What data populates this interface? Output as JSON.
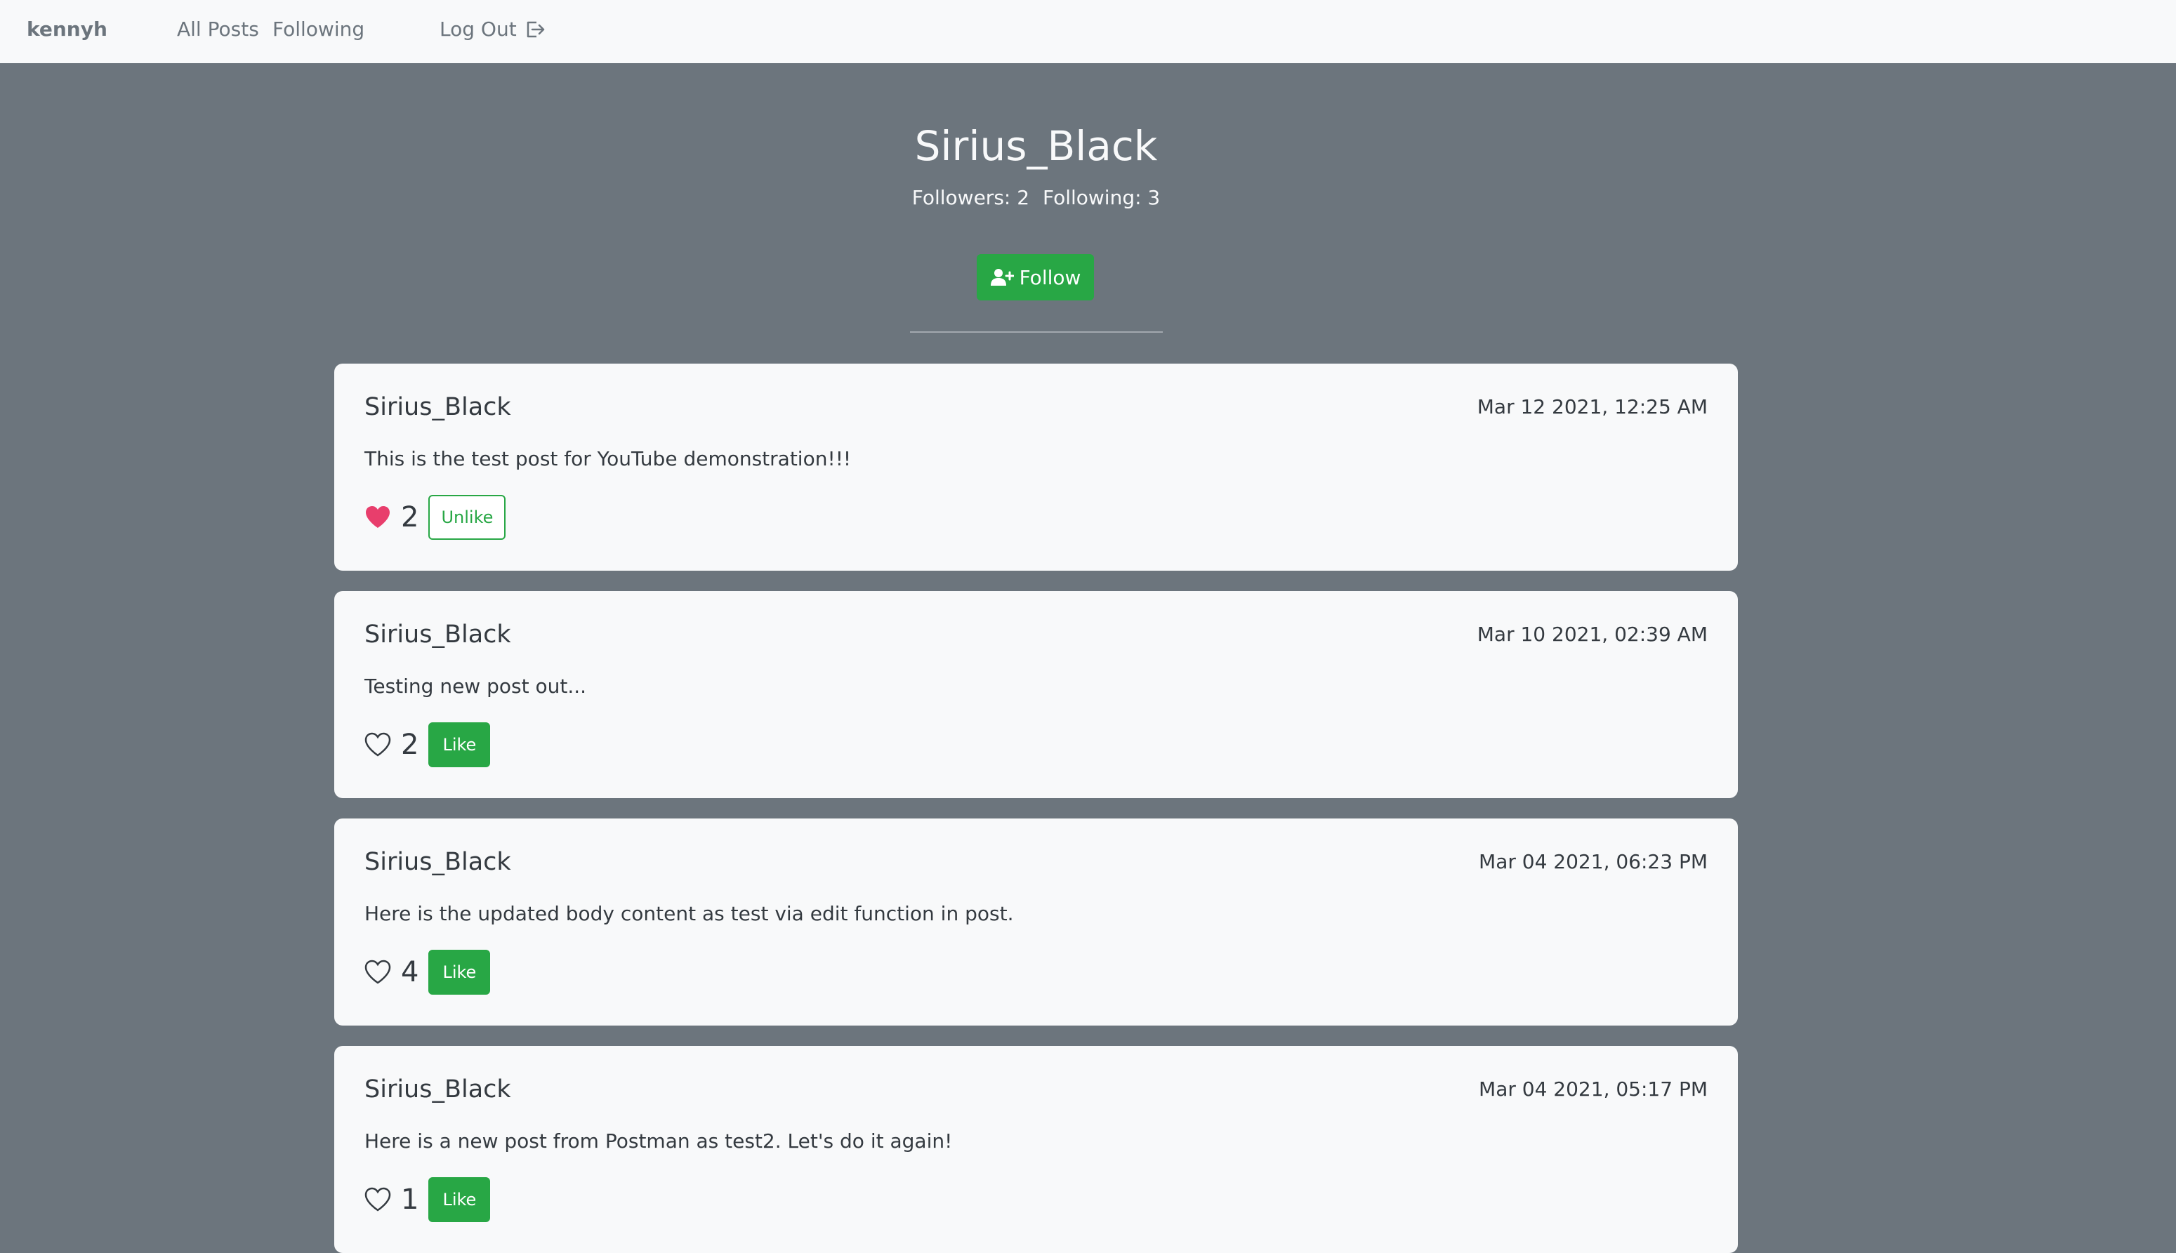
{
  "navbar": {
    "brand": "kennyh",
    "links": {
      "all_posts": "All Posts",
      "following": "Following",
      "logout": "Log Out"
    }
  },
  "profile": {
    "username": "Sirius_Black",
    "followers_label": "Followers: 2",
    "following_label": "Following: 3",
    "follow_button": "Follow"
  },
  "posts": [
    {
      "author": "Sirius_Black",
      "date": "Mar 12 2021, 12:25 AM",
      "body": "This is the test post for YouTube demonstration!!!",
      "likes": "2",
      "liked": true,
      "button": "Unlike"
    },
    {
      "author": "Sirius_Black",
      "date": "Mar 10 2021, 02:39 AM",
      "body": "Testing new post out...",
      "likes": "2",
      "liked": false,
      "button": "Like"
    },
    {
      "author": "Sirius_Black",
      "date": "Mar 04 2021, 06:23 PM",
      "body": "Here is the updated body content as test via edit function in post.",
      "likes": "4",
      "liked": false,
      "button": "Like"
    },
    {
      "author": "Sirius_Black",
      "date": "Mar 04 2021, 05:17 PM",
      "body": "Here is a new post from Postman as test2. Let's do it again!",
      "likes": "1",
      "liked": false,
      "button": "Like"
    }
  ],
  "colors": {
    "page_background": "#6c757d",
    "navbar_background": "#f8f9fa",
    "accent_green": "#28a745",
    "heart_filled": "#e83e6c"
  },
  "icons": {
    "logout": "logout-icon",
    "follow": "user-plus-icon",
    "liked": "heart-filled-icon",
    "not_liked": "heart-outline-icon"
  }
}
